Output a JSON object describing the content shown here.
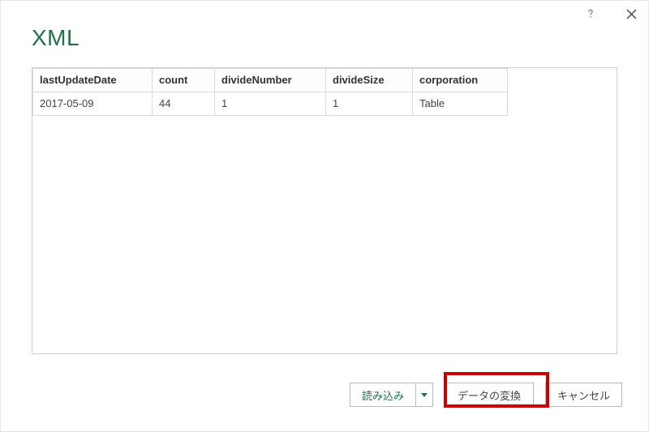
{
  "window": {
    "title": "XML"
  },
  "table": {
    "headers": {
      "lastUpdateDate": "lastUpdateDate",
      "count": "count",
      "divideNumber": "divideNumber",
      "divideSize": "divideSize",
      "corporation": "corporation"
    },
    "rows": [
      {
        "lastUpdateDate": "2017-05-09",
        "count": "44",
        "divideNumber": "1",
        "divideSize": "1",
        "corporation": "Table"
      }
    ]
  },
  "footer": {
    "load_label": "読み込み",
    "transform_label": "データの変換",
    "cancel_label": "キャンセル"
  }
}
